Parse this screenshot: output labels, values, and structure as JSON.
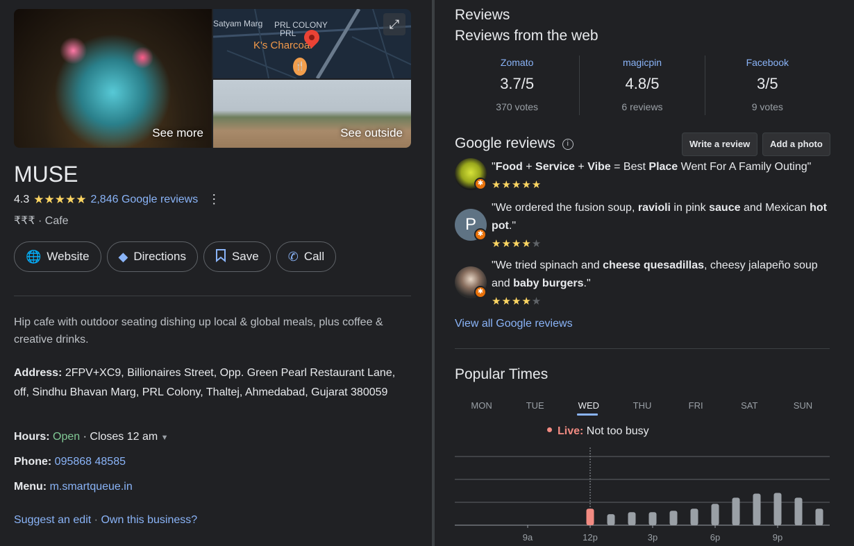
{
  "photos": {
    "see_more": "See more",
    "see_outside": "See outside",
    "map_labels": [
      "Satyam Marg",
      "PRL COLONY",
      "PRL"
    ],
    "map_place": "K's Charcoal"
  },
  "place": {
    "name": "MUSE",
    "rating": "4.3",
    "stars": "★★★★★",
    "reviews_link": "2,846 Google reviews",
    "price_category": "₹₹₹ · Cafe"
  },
  "actions": [
    {
      "label": "Website",
      "icon": "globe-icon"
    },
    {
      "label": "Directions",
      "icon": "directions-icon"
    },
    {
      "label": "Save",
      "icon": "bookmark-icon"
    },
    {
      "label": "Call",
      "icon": "phone-icon"
    }
  ],
  "description": "Hip cafe with outdoor seating dishing up local & global meals, plus coffee & creative drinks.",
  "details": {
    "address_label": "Address:",
    "address": "2FPV+XC9, Billionaires Street, Opp. Green Pearl Restaurant Lane, off, Sindhu Bhavan Marg, PRL Colony, Thaltej, Ahmedabad, Gujarat 380059",
    "hours_label": "Hours:",
    "hours_status": "Open",
    "hours_close": "· Closes 12 am",
    "phone_label": "Phone:",
    "phone": "095868 48585",
    "menu_label": "Menu:",
    "menu": "m.smartqueue.in"
  },
  "footer": {
    "suggest": "Suggest an edit",
    "sep": "·",
    "own": "Own this business?"
  },
  "reviews": {
    "heading": "Reviews",
    "web_heading": "Reviews from the web",
    "web": [
      {
        "source": "Zomato",
        "score": "3.7/5",
        "votes": "370 votes"
      },
      {
        "source": "magicpin",
        "score": "4.8/5",
        "votes": "6 reviews"
      },
      {
        "source": "Facebook",
        "score": "3/5",
        "votes": "9 votes"
      }
    ],
    "google_heading": "Google reviews",
    "write_review": "Write a review",
    "add_photo": "Add a photo",
    "items": [
      {
        "html": "\"<b>Food</b> + <b>Service</b> + <b>Vibe</b> = Best <b>Place</b> Went For A Family Outing\"",
        "rating": 5
      },
      {
        "html": "\"We ordered the fusion soup, <b>ravioli</b> in pink <b>sauce</b> and Mexican <b>hot pot</b>.\"",
        "rating": 4,
        "initial": "P"
      },
      {
        "html": "\"We tried spinach and <b>cheese quesadillas</b>, cheesy jalapeño soup and <b>baby burgers</b>.\"",
        "rating": 4
      }
    ],
    "view_all": "View all Google reviews"
  },
  "popular_times": {
    "heading": "Popular Times",
    "days": [
      "MON",
      "TUE",
      "WED",
      "THU",
      "FRI",
      "SAT",
      "SUN"
    ],
    "active_day": "WED",
    "live_label": "Live:",
    "live_status": "Not too busy",
    "time_labels": [
      "9a",
      "12p",
      "3p",
      "6p",
      "9p"
    ],
    "live_color": "#f28b82",
    "bar_color": "#9aa0a6"
  },
  "chart_data": {
    "type": "bar",
    "categories": [
      "12p",
      "1p",
      "2p",
      "3p",
      "4p",
      "5p",
      "6p",
      "7p",
      "8p",
      "9p",
      "10p",
      "11p"
    ],
    "values": [
      24,
      16,
      19,
      19,
      21,
      24,
      31,
      40,
      46,
      47,
      40,
      24
    ],
    "live_index": 0,
    "ylim": [
      0,
      100
    ]
  }
}
